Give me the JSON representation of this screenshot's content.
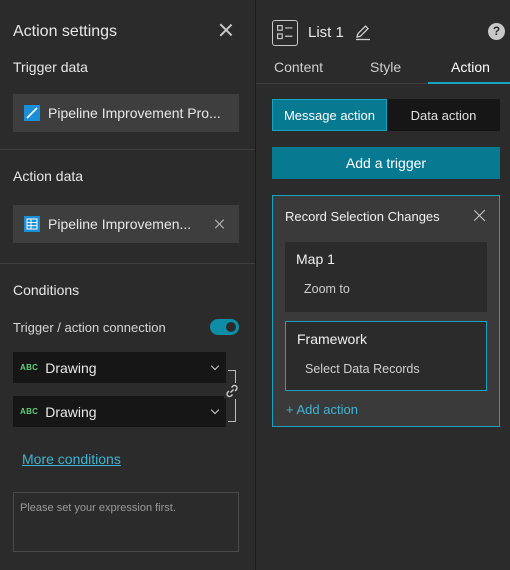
{
  "left_panel": {
    "title": "Action settings",
    "trigger_data": {
      "label": "Trigger data",
      "source_name": "Pipeline Improvement Pro..."
    },
    "action_data": {
      "label": "Action data",
      "source_name": "Pipeline Improvemen..."
    },
    "conditions": {
      "label": "Conditions",
      "toggle_label": "Trigger / action connection",
      "toggle_on": true,
      "field1": {
        "type_badge": "ABC",
        "value": "Drawing"
      },
      "field2": {
        "type_badge": "ABC",
        "value": "Drawing"
      },
      "more_link": "More conditions",
      "expression_placeholder": "Please set your expression first."
    }
  },
  "right_panel": {
    "widget_title": "List 1",
    "help_glyph": "?",
    "tabs": [
      {
        "label": "Content",
        "active": false
      },
      {
        "label": "Style",
        "active": false
      },
      {
        "label": "Action",
        "active": true
      }
    ],
    "segments": [
      {
        "label": "Message action",
        "active": true
      },
      {
        "label": "Data action",
        "active": false
      }
    ],
    "add_trigger_label": "Add a trigger",
    "trigger_card": {
      "title": "Record Selection Changes",
      "actions": [
        {
          "name": "Map 1",
          "action": "Zoom to",
          "selected": false
        },
        {
          "name": "Framework",
          "action": "Select Data Records",
          "selected": true
        }
      ],
      "add_action_label": "+ Add action"
    }
  },
  "colors": {
    "accent": "#077a92",
    "accent_border": "#17a3c1",
    "link": "#3fb5d3",
    "panel_bg": "#2b2b2b"
  },
  "icons": {
    "close": "close-icon",
    "layer": "feature-layer-icon",
    "table": "table-icon",
    "chevron": "chevron-down-icon",
    "link": "link-icon",
    "list_widget": "list-widget-icon",
    "edit": "pencil-icon",
    "help": "help-icon"
  }
}
